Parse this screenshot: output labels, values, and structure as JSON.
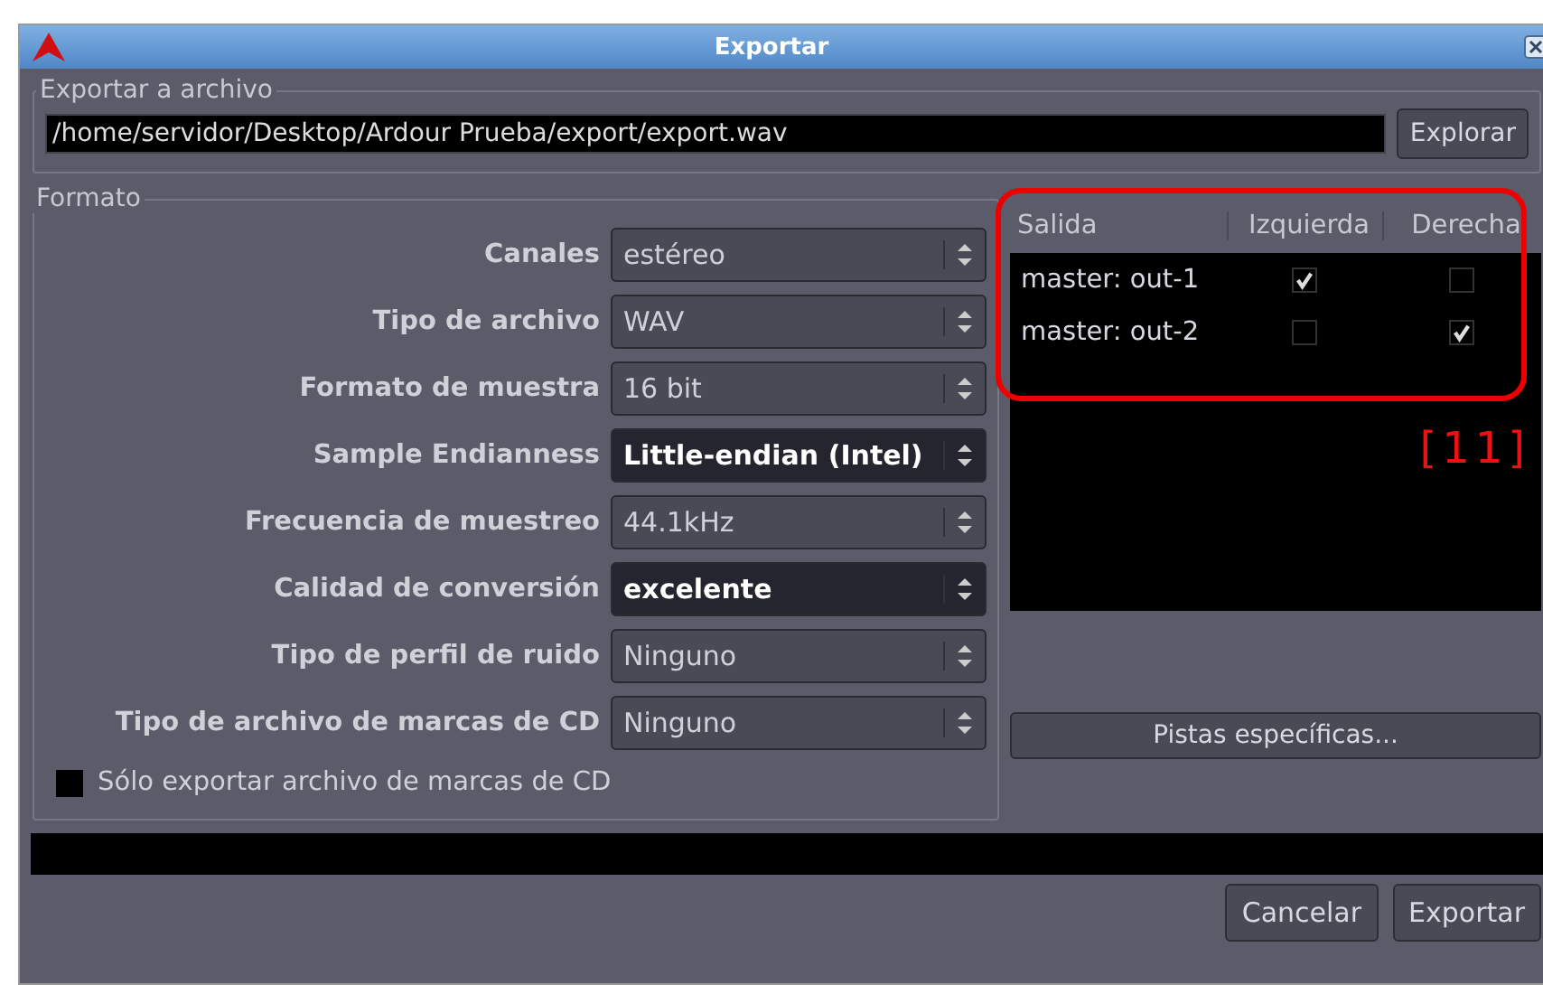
{
  "window": {
    "title": "Exportar"
  },
  "export_file": {
    "title": "Exportar a archivo",
    "path": "/home/servidor/Desktop/Ardour Prueba/export/export.wav",
    "browse": "Explorar"
  },
  "format": {
    "title": "Formato",
    "fields": [
      {
        "label": "Canales",
        "value": "estéreo",
        "highlighted": false
      },
      {
        "label": "Tipo de archivo",
        "value": "WAV",
        "highlighted": false
      },
      {
        "label": "Formato de muestra",
        "value": "16 bit",
        "highlighted": false
      },
      {
        "label": "Sample Endianness",
        "value": "Little-endian (Intel)",
        "highlighted": true
      },
      {
        "label": "Frecuencia de muestreo",
        "value": "44.1kHz",
        "highlighted": false
      },
      {
        "label": "Calidad de conversión",
        "value": "excelente",
        "highlighted": true
      },
      {
        "label": "Tipo de perfil de ruido",
        "value": "Ninguno",
        "highlighted": false
      },
      {
        "label": "Tipo de archivo de marcas de CD",
        "value": "Ninguno",
        "highlighted": false
      }
    ],
    "cd_only": {
      "label": "Sólo exportar archivo de marcas de CD",
      "checked": false
    }
  },
  "outputs": {
    "columns": [
      "Salida",
      "Izquierda",
      "Derecha"
    ],
    "rows": [
      {
        "name": "master: out-1",
        "left": true,
        "right": false
      },
      {
        "name": "master: out-2",
        "left": false,
        "right": true
      }
    ],
    "annotation": "[11]",
    "tracks_button": "Pistas específicas..."
  },
  "buttons": [
    "Cancelar",
    "Exportar"
  ]
}
